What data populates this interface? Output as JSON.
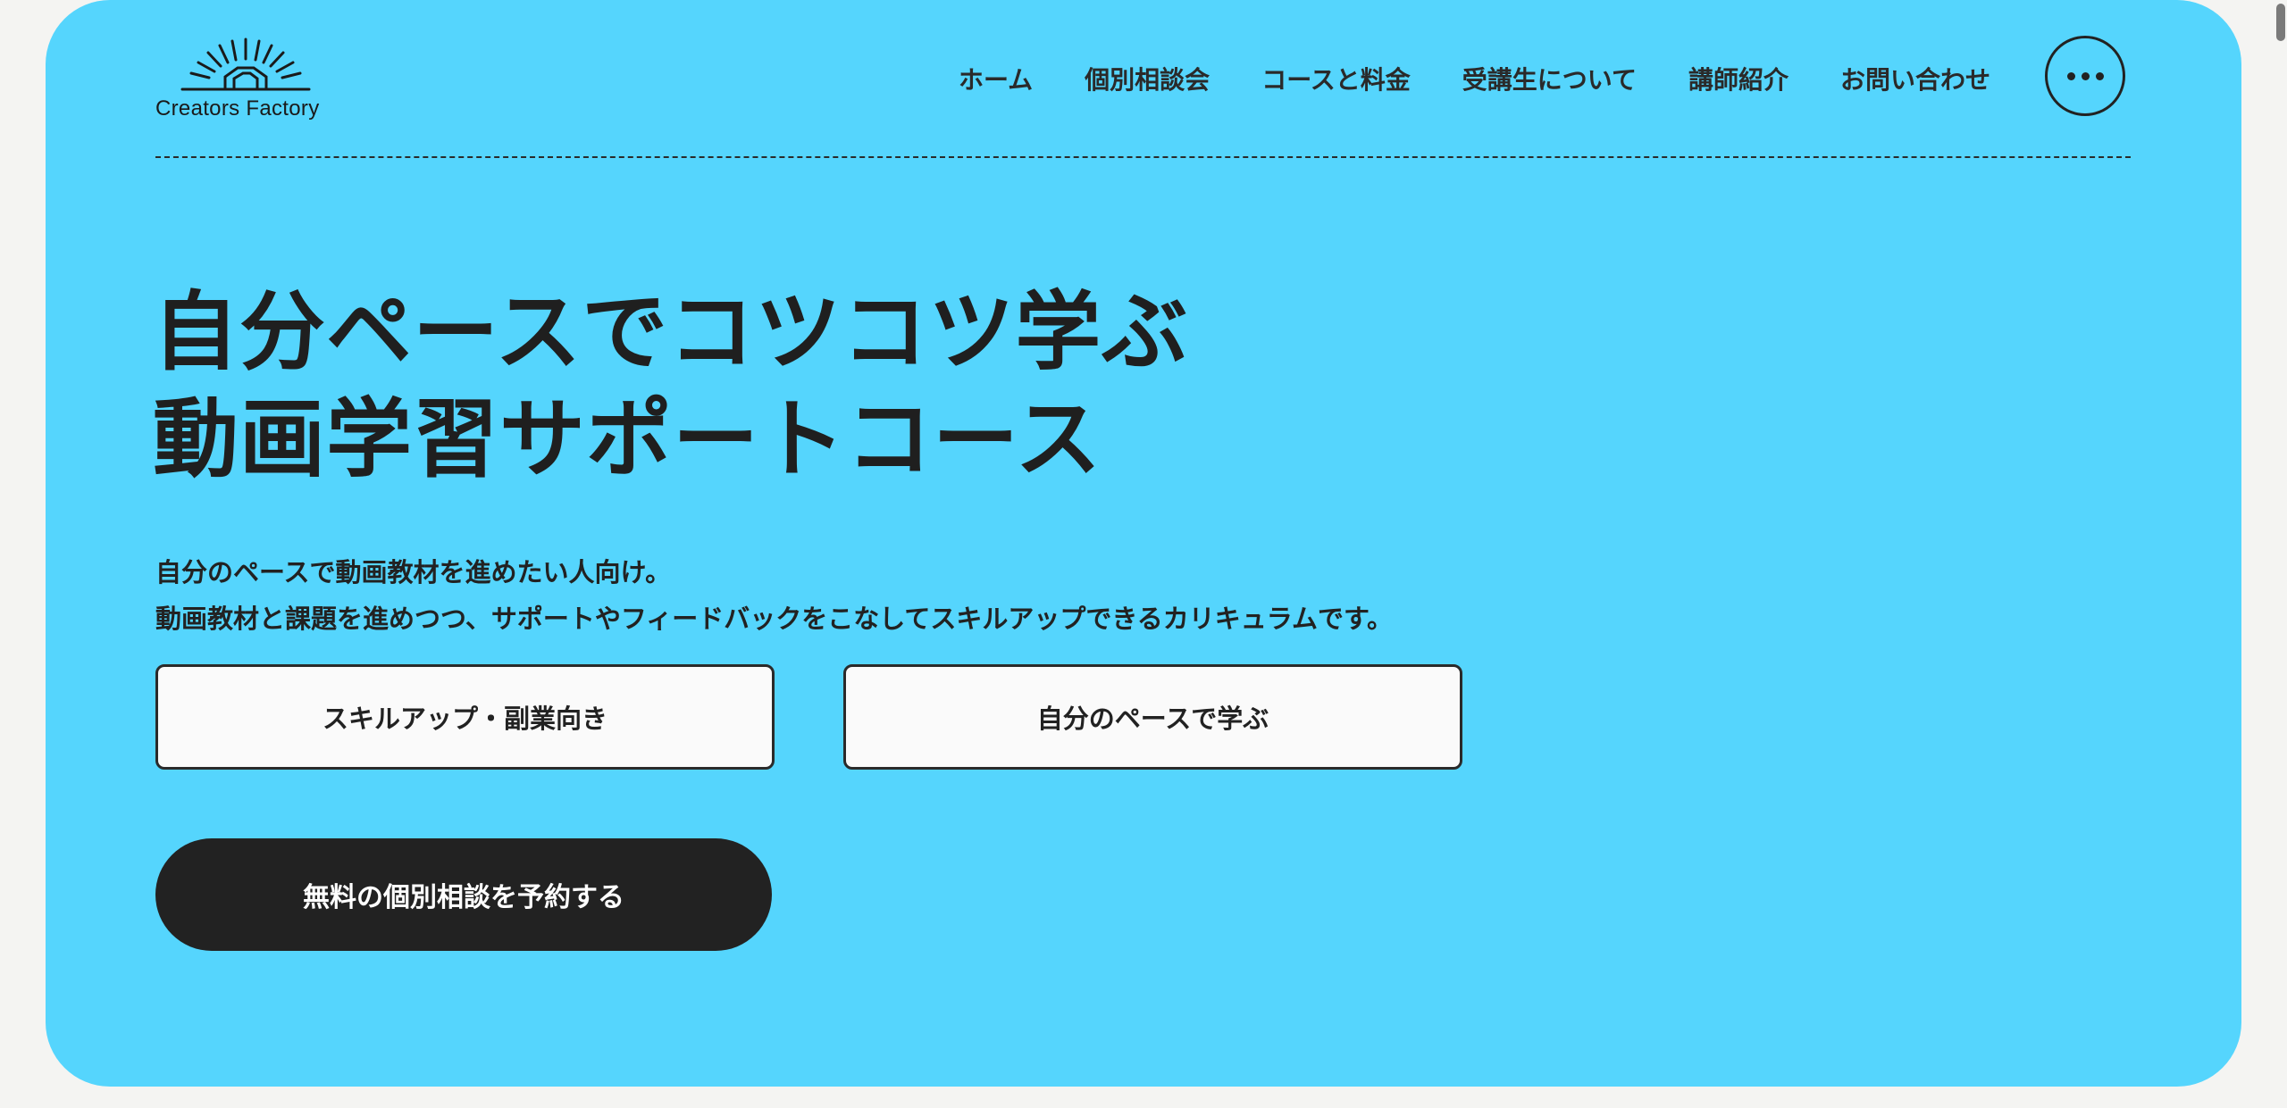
{
  "header": {
    "logo_text": "Creators Factory",
    "nav": [
      {
        "label": "ホーム"
      },
      {
        "label": "個別相談会"
      },
      {
        "label": "コースと料金"
      },
      {
        "label": "受講生について"
      },
      {
        "label": "講師紹介"
      },
      {
        "label": "お問い合わせ"
      }
    ],
    "menu_icon": "more-horizontal-icon"
  },
  "hero": {
    "headline_line1": "自分ペースでコツコツ学ぶ",
    "headline_line2": "動画学習サポートコース",
    "desc_line1": "自分のペースで動画教材を進めたい人向け。",
    "desc_line2": "動画教材と課題を進めつつ、サポートやフィードバックをこなしてスキルアップできるカリキュラムです。",
    "tags": [
      {
        "label": "スキルアップ・副業向き"
      },
      {
        "label": "自分のペースで学ぶ"
      }
    ],
    "cta_label": "無料の個別相談を予約する"
  },
  "colors": {
    "hero_background": "#55d5fd",
    "text": "#222222",
    "cta_background": "#222222",
    "tag_background": "#fafafa"
  }
}
